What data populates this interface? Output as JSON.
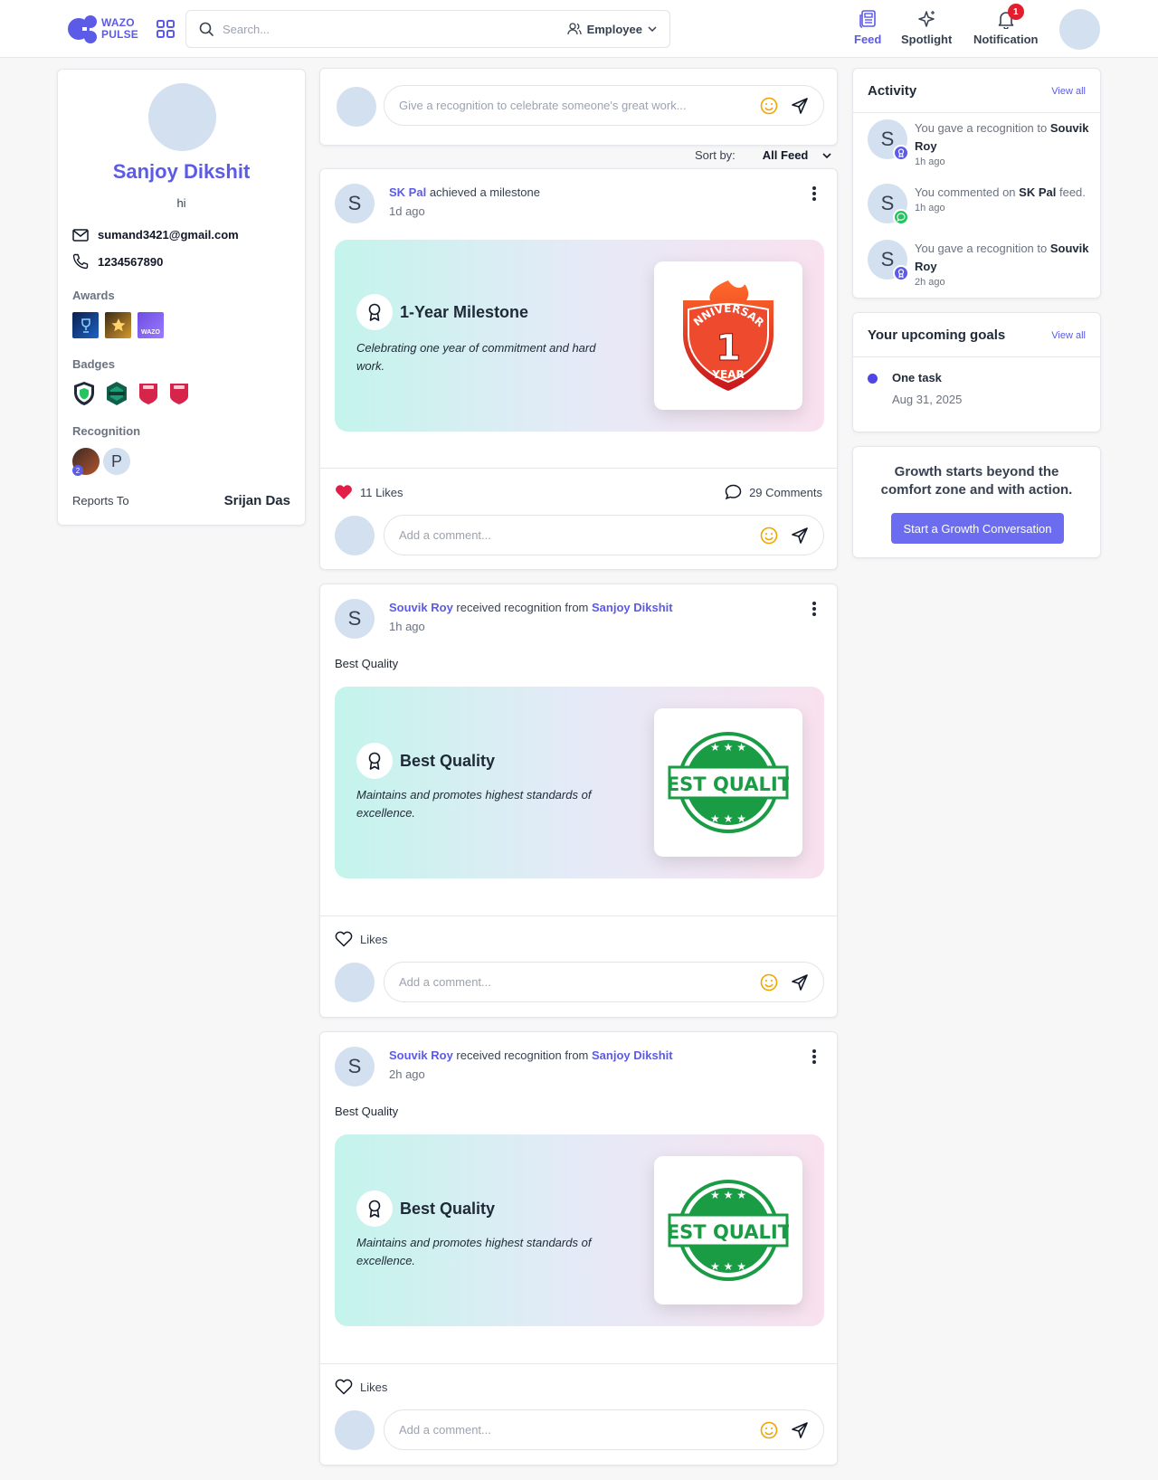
{
  "header": {
    "logo_line1": "WAZO",
    "logo_line2": "PULSE",
    "search_placeholder": "Search...",
    "employee_filter": "Employee",
    "nav": [
      {
        "label": "Feed",
        "icon": "feed-icon",
        "active": true
      },
      {
        "label": "Spotlight",
        "icon": "sparkle-icon",
        "active": false
      },
      {
        "label": "Notification",
        "icon": "bell-icon",
        "active": false
      }
    ],
    "notification_count": "1"
  },
  "profile": {
    "name": "Sanjoy Dikshit",
    "bio": "hi",
    "email": "sumand3421@gmail.com",
    "phone": "1234567890",
    "awards_label": "Awards",
    "badges_label": "Badges",
    "recognition_label": "Recognition",
    "recognition_initial": "P",
    "recognition_count": "2",
    "reports_to_label": "Reports To",
    "reports_to": "Srijan Das",
    "award_thumb_text": "WAZO"
  },
  "composer": {
    "placeholder": "Give a recognition to celebrate someone's great work..."
  },
  "sort": {
    "label": "Sort by:",
    "value": "All Feed"
  },
  "posts": [
    {
      "initial": "S",
      "actor": "SK Pal",
      "action": "achieved a milestone",
      "time": "1d ago",
      "text": "",
      "banner_title": "1-Year Milestone",
      "banner_desc": "Celebrating one year of commitment and hard work.",
      "image_words": [
        "ANNIVERSARY",
        "1",
        "YEAR"
      ],
      "likes": "11 Likes",
      "comments": "29 Comments",
      "comment_placeholder": "Add a comment..."
    },
    {
      "initial": "S",
      "actor": "Souvik Roy",
      "action": "received recognition from",
      "target": "Sanjoy Dikshit",
      "time": "1h ago",
      "text": "Best Quality",
      "banner_title": "Best Quality",
      "banner_desc": "Maintains and promotes highest standards of excellence.",
      "image_words": [
        "BEST QUALITY"
      ],
      "likes": "Likes",
      "comment_placeholder": "Add a comment..."
    },
    {
      "initial": "S",
      "actor": "Souvik Roy",
      "action": "received recognition from",
      "target": "Sanjoy Dikshit",
      "time": "2h ago",
      "text": "Best Quality",
      "banner_title": "Best Quality",
      "banner_desc": "Maintains and promotes highest standards of excellence.",
      "image_words": [
        "BEST QUALITY"
      ],
      "likes": "Likes",
      "comment_placeholder": "Add a comment..."
    }
  ],
  "activity": {
    "title": "Activity",
    "view_all": "View all",
    "items": [
      {
        "initial": "S",
        "pre": "You gave a recognition to",
        "bold": "Souvik Roy",
        "post": "",
        "time": "1h ago",
        "sub_icon": "award-icon",
        "sub_color": "#5b5be8"
      },
      {
        "initial": "S",
        "pre": "You commented on",
        "bold": "SK Pal",
        "post": "feed.",
        "time": "1h ago",
        "sub_icon": "comment-icon",
        "sub_color": "#22c55e"
      },
      {
        "initial": "S",
        "pre": "You gave a recognition to",
        "bold": "Souvik Roy",
        "post": "",
        "time": "2h ago",
        "sub_icon": "award-icon",
        "sub_color": "#5b5be8"
      }
    ]
  },
  "goals": {
    "title": "Your upcoming goals",
    "view_all": "View all",
    "items": [
      {
        "name": "One task",
        "date": "Aug 31, 2025"
      }
    ]
  },
  "growth": {
    "quote": "Growth starts beyond the comfort zone and with action.",
    "button": "Start a Growth Conversation"
  },
  "colors": {
    "accent": "#5b5be8",
    "like_red": "#e11d48",
    "badge_red": "#e11d2e",
    "avatar_bg": "#d3e0ef"
  }
}
